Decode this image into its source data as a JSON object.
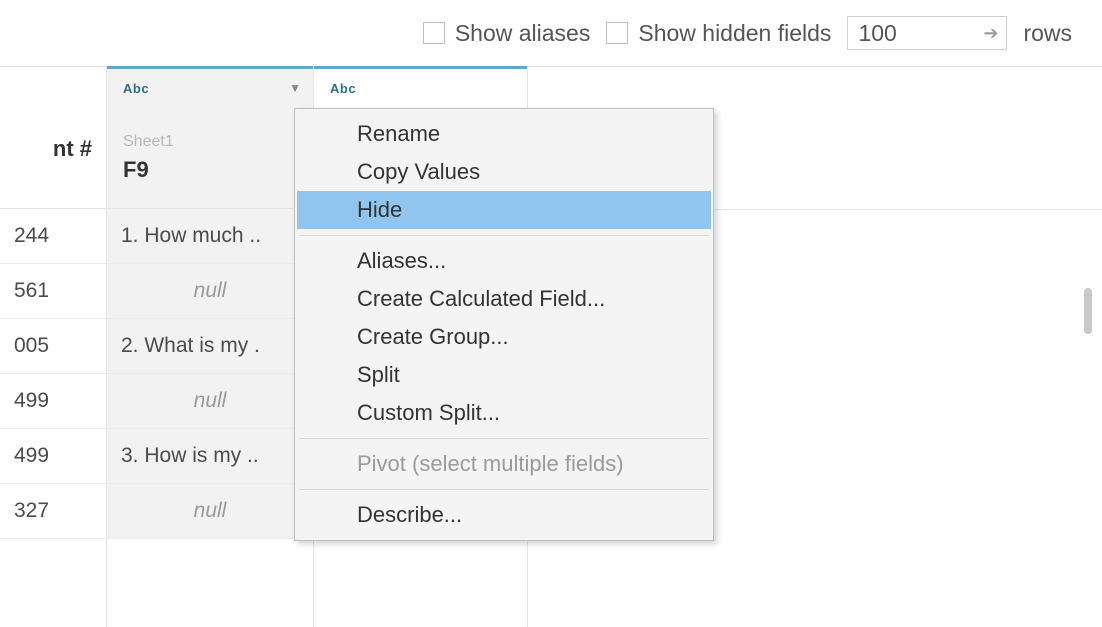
{
  "controls": {
    "show_aliases_label": "Show aliases",
    "show_hidden_label": "Show hidden fields",
    "rows_value": "100",
    "rows_label": "rows"
  },
  "columns": [
    {
      "type": "",
      "sheet": "",
      "field": "nt #",
      "type_visible": false,
      "rows": [
        "244",
        "561",
        "005",
        "499",
        "499",
        "327"
      ]
    },
    {
      "type": "Abc",
      "sheet": "Sheet1",
      "field": "F9",
      "type_visible": true,
      "rows": [
        "1. How much ..",
        "null",
        "2. What is my .",
        "null",
        "3. How is my ..",
        "null"
      ]
    },
    {
      "type": "Abc",
      "sheet": "",
      "field": "",
      "type_visible": true,
      "rows": [
        "",
        "",
        "",
        "",
        "",
        ""
      ]
    }
  ],
  "menu": {
    "items": [
      {
        "label": "Rename",
        "highlight": false,
        "disabled": false,
        "sep_after": false
      },
      {
        "label": "Copy Values",
        "highlight": false,
        "disabled": false,
        "sep_after": false
      },
      {
        "label": "Hide",
        "highlight": true,
        "disabled": false,
        "sep_after": true
      },
      {
        "label": "Aliases...",
        "highlight": false,
        "disabled": false,
        "sep_after": false
      },
      {
        "label": "Create Calculated Field...",
        "highlight": false,
        "disabled": false,
        "sep_after": false
      },
      {
        "label": "Create Group...",
        "highlight": false,
        "disabled": false,
        "sep_after": false
      },
      {
        "label": "Split",
        "highlight": false,
        "disabled": false,
        "sep_after": false
      },
      {
        "label": "Custom Split...",
        "highlight": false,
        "disabled": false,
        "sep_after": true
      },
      {
        "label": "Pivot (select multiple fields)",
        "highlight": false,
        "disabled": true,
        "sep_after": true
      },
      {
        "label": "Describe...",
        "highlight": false,
        "disabled": false,
        "sep_after": false
      }
    ]
  }
}
